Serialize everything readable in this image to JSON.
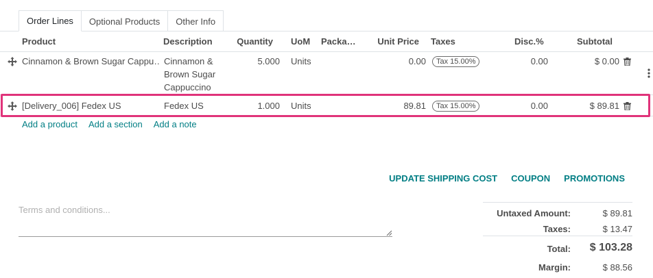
{
  "tabs": [
    {
      "label": "Order Lines",
      "active": true
    },
    {
      "label": "Optional Products",
      "active": false
    },
    {
      "label": "Other Info",
      "active": false
    }
  ],
  "columns": {
    "product": "Product",
    "description": "Description",
    "quantity": "Quantity",
    "uom": "UoM",
    "packaging": "Packa…",
    "unit_price": "Unit Price",
    "taxes": "Taxes",
    "discount": "Disc.%",
    "subtotal": "Subtotal"
  },
  "rows": [
    {
      "product": "Cinnamon & Brown Sugar Cappu…",
      "description_lines": [
        "Cinnamon &",
        "Brown Sugar",
        "Cappuccino"
      ],
      "quantity": "5.000",
      "uom": "Units",
      "unit_price": "0.00",
      "tax": "Tax 15.00%",
      "discount": "0.00",
      "subtotal": "$ 0.00"
    },
    {
      "product": "[Delivery_006] Fedex US",
      "description_lines": [
        "Fedex US"
      ],
      "quantity": "1.000",
      "uom": "Units",
      "unit_price": "89.81",
      "tax": "Tax 15.00%",
      "discount": "0.00",
      "subtotal": "$ 89.81",
      "highlighted": true
    }
  ],
  "add_links": {
    "product": "Add a product",
    "section": "Add a section",
    "note": "Add a note"
  },
  "actions": {
    "update_shipping": "UPDATE SHIPPING COST",
    "coupon": "COUPON",
    "promotions": "PROMOTIONS"
  },
  "terms": {
    "placeholder": "Terms and conditions..."
  },
  "totals": {
    "untaxed_label": "Untaxed Amount:",
    "untaxed_value": "$ 89.81",
    "taxes_label": "Taxes:",
    "taxes_value": "$ 13.47",
    "total_label": "Total:",
    "total_value": "$ 103.28",
    "margin_label": "Margin:",
    "margin_value": "$ 88.56"
  },
  "colors": {
    "accent": "#017e84",
    "highlight": "#e0337a"
  },
  "icons": {
    "drag": "drag-handle-icon",
    "trash": "trash-icon",
    "kebab": "kebab-menu-icon"
  }
}
